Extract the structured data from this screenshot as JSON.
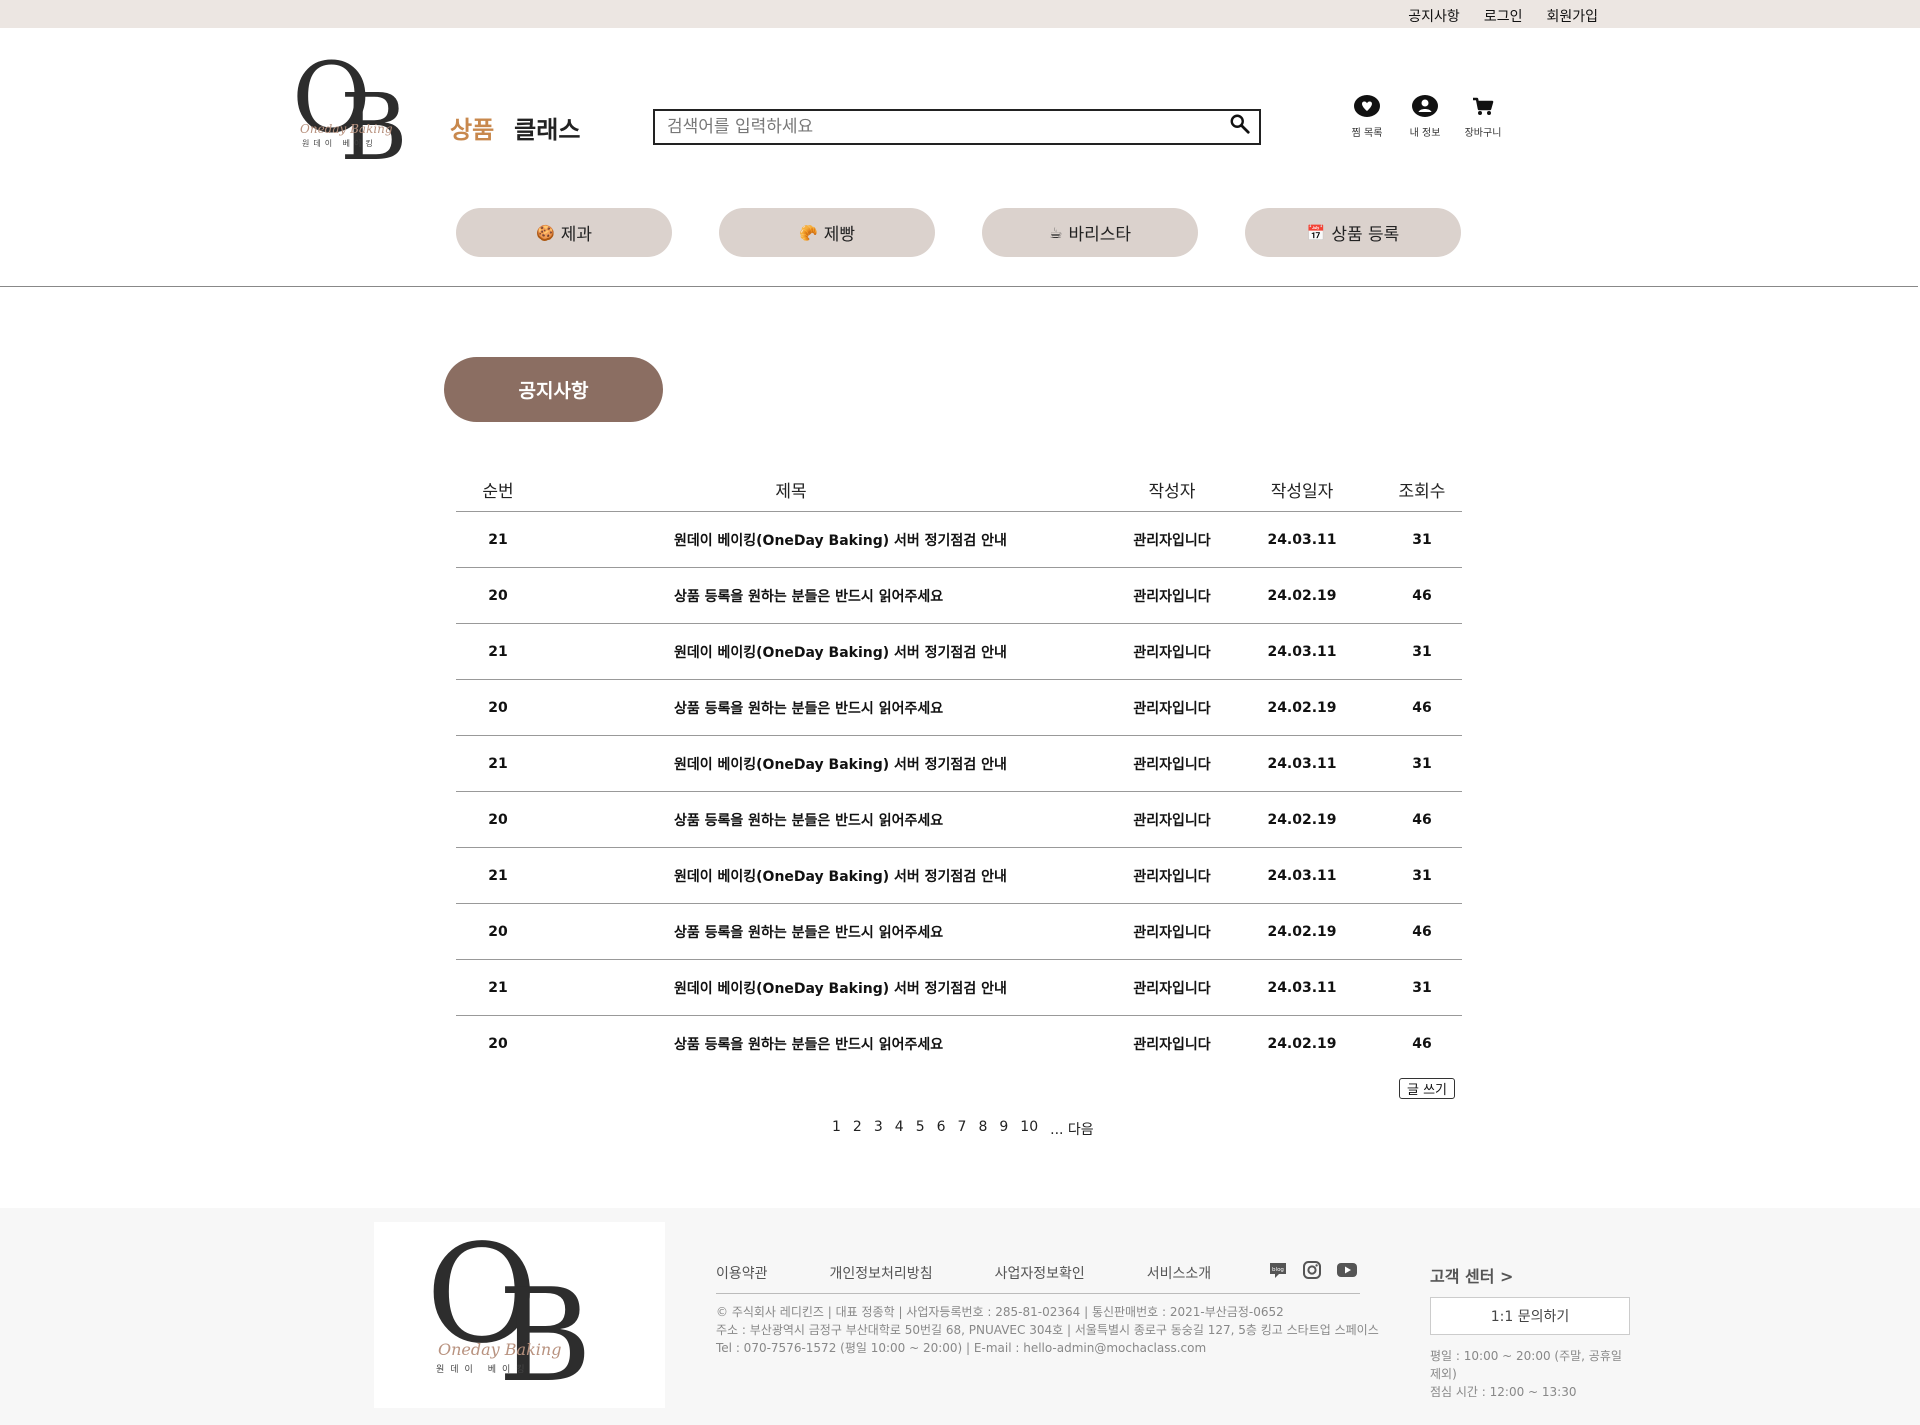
{
  "topbar": {
    "links": [
      "공지사항",
      "로그인",
      "회원가입"
    ]
  },
  "logo": {
    "letter1": "O",
    "letter2": "B",
    "script": "Oneday Baking",
    "korean": "원데이 베이킹"
  },
  "header": {
    "category_links": {
      "goods": "상품",
      "classes": "클래스"
    },
    "search": {
      "placeholder": "검색어를 입력하세요"
    },
    "user_icons": {
      "wishlist": "찜 목록",
      "mypage": "내 정보",
      "cart": "장바구니"
    }
  },
  "category_nav": [
    {
      "emoji": "🍪",
      "label": "제과"
    },
    {
      "emoji": "🥐",
      "label": "제빵"
    },
    {
      "emoji": "☕",
      "label": "바리스타"
    },
    {
      "emoji": "📅",
      "label": "상품 등록"
    }
  ],
  "notice": {
    "badge": "공지사항",
    "columns": {
      "no": "순번",
      "title": "제목",
      "author": "작성자",
      "date": "작성일자",
      "views": "조회수"
    },
    "rows": [
      {
        "no": "21",
        "title": "원데이 베이킹(OneDay Baking) 서버 정기점검 안내",
        "author": "관리자입니다",
        "date": "24.03.11",
        "views": "31"
      },
      {
        "no": "20",
        "title": "상품 등록을 원하는 분들은 반드시 읽어주세요",
        "author": "관리자입니다",
        "date": "24.02.19",
        "views": "46"
      },
      {
        "no": "21",
        "title": "원데이 베이킹(OneDay Baking) 서버 정기점검 안내",
        "author": "관리자입니다",
        "date": "24.03.11",
        "views": "31"
      },
      {
        "no": "20",
        "title": "상품 등록을 원하는 분들은 반드시 읽어주세요",
        "author": "관리자입니다",
        "date": "24.02.19",
        "views": "46"
      },
      {
        "no": "21",
        "title": "원데이 베이킹(OneDay Baking) 서버 정기점검 안내",
        "author": "관리자입니다",
        "date": "24.03.11",
        "views": "31"
      },
      {
        "no": "20",
        "title": "상품 등록을 원하는 분들은 반드시 읽어주세요",
        "author": "관리자입니다",
        "date": "24.02.19",
        "views": "46"
      },
      {
        "no": "21",
        "title": "원데이 베이킹(OneDay Baking) 서버 정기점검 안내",
        "author": "관리자입니다",
        "date": "24.03.11",
        "views": "31"
      },
      {
        "no": "20",
        "title": "상품 등록을 원하는 분들은 반드시 읽어주세요",
        "author": "관리자입니다",
        "date": "24.02.19",
        "views": "46"
      },
      {
        "no": "21",
        "title": "원데이 베이킹(OneDay Baking) 서버 정기점검 안내",
        "author": "관리자입니다",
        "date": "24.03.11",
        "views": "31"
      },
      {
        "no": "20",
        "title": "상품 등록을 원하는 분들은 반드시 읽어주세요",
        "author": "관리자입니다",
        "date": "24.02.19",
        "views": "46"
      }
    ],
    "write_button": "글 쓰기",
    "pagination": [
      "1",
      "2",
      "3",
      "4",
      "5",
      "6",
      "7",
      "8",
      "9",
      "10"
    ],
    "pagination_next": "... 다음"
  },
  "footer": {
    "links": [
      "이용약관",
      "개인정보처리방침",
      "사업자정보확인",
      "서비스소개"
    ],
    "info_lines": [
      "© 주식회사 레디킨즈 | 대표 정종학 | 사업자등록번호 : 285-81-02364 | 통신판매번호 : 2021-부산금정-0652",
      "주소 : 부산광역시 금정구 부산대학로 50번길 68, PNUAVEC 304호 | 서울특별시 종로구 동숭길 127, 5층 킹고 스타트업 스페이스",
      "Tel : 070-7576-1572 (평일 10:00 ~ 20:00) | E-mail : hello-admin@mochaclass.com"
    ],
    "customer_center": {
      "title": "고객 센터 >",
      "inquiry_button": "1:1 문의하기",
      "hours": [
        "평일 : 10:00 ~ 20:00 (주말, 공휴일 제외)",
        "점심 시간 : 12:00 ~ 13:30"
      ]
    },
    "social_icons": [
      "blog-icon",
      "instagram-icon",
      "youtube-icon"
    ],
    "blog_label": "blog"
  },
  "colors": {
    "accent": "#c8884d",
    "badge": "#8b6e62",
    "pill": "#dbd2cd",
    "topbar": "#ece6e2"
  }
}
